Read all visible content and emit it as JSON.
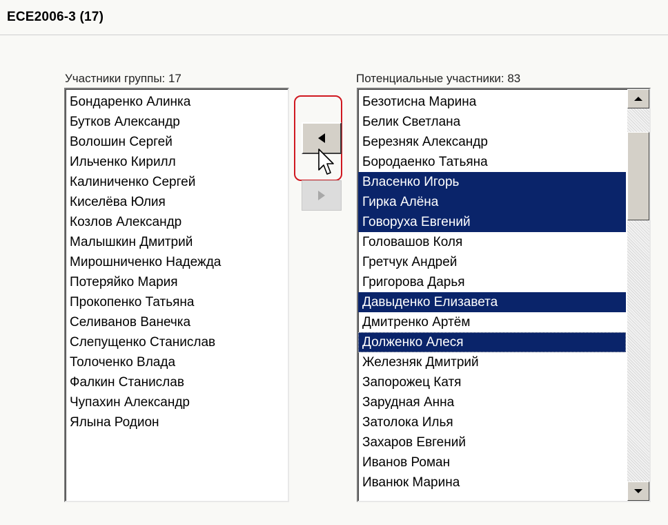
{
  "header": {
    "title": "ECE2006-3 (17)"
  },
  "members": {
    "caption": "Участники группы: 17",
    "items": [
      "Бондаренко Алинка",
      "Бутков Александр",
      "Волошин Сергей",
      "Ильченко Кирилл",
      "Калиниченко Сергей",
      "Киселёва Юлия",
      "Козлов Александр",
      "Малышкин Дмитрий",
      "Мирошниченко Надежда",
      "Потеряйко Мария",
      "Прокопенко Татьяна",
      "Селиванов Ванечка",
      "Слепущенко Станислав",
      "Толоченко Влада",
      "Фалкин Станислав",
      "Чупахин Александр",
      "Ялына Родион"
    ]
  },
  "candidates": {
    "caption": "Потенциальные участники: 83",
    "items": [
      "Безотисна Марина",
      "Белик Светлана",
      "Березняк Александр",
      "Бородаенко Татьяна",
      "Власенко Игорь",
      "Гирка Алёна",
      "Говоруха Евгений",
      "Головашов Коля",
      "Гретчук Андрей",
      "Григорова Дарья",
      "Давыденко Елизавета",
      "Дмитренко Артём",
      "Долженко Алеся",
      "Железняк Дмитрий",
      "Запорожец Катя",
      "Зарудная Анна",
      "Затолока Илья",
      "Захаров Евгений",
      "Иванов Роман",
      "Иванюк Марина"
    ],
    "selected_indices": [
      4,
      5,
      6,
      10,
      12
    ],
    "focused_index": 12
  },
  "buttons": {
    "add_to_group_icon": "triangle-left-icon",
    "remove_from_group_icon": "triangle-right-icon"
  },
  "colors": {
    "selection": "#0a246a",
    "highlight_ring": "#d01820"
  }
}
